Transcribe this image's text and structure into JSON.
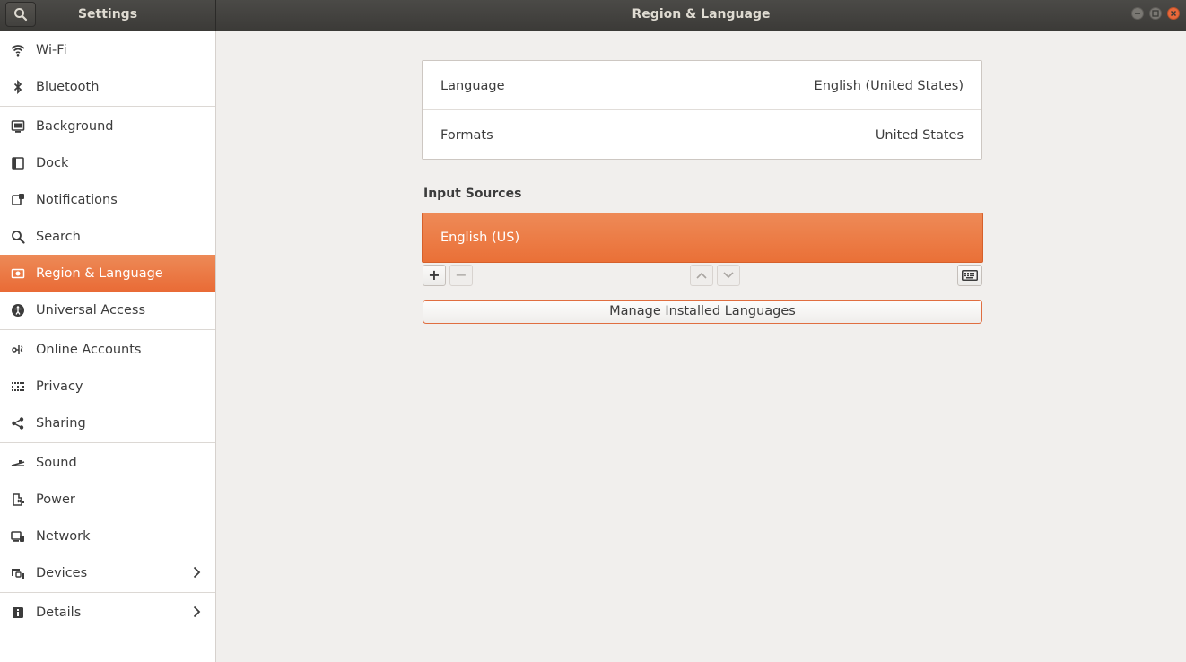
{
  "titlebar": {
    "app_title": "Settings",
    "window_title": "Region & Language"
  },
  "sidebar": {
    "items": [
      {
        "label": "Wi-Fi",
        "icon": "wifi-icon"
      },
      {
        "label": "Bluetooth",
        "icon": "bluetooth-icon"
      },
      {
        "label": "Background",
        "icon": "background-icon"
      },
      {
        "label": "Dock",
        "icon": "dock-icon"
      },
      {
        "label": "Notifications",
        "icon": "notifications-icon"
      },
      {
        "label": "Search",
        "icon": "search-icon"
      },
      {
        "label": "Region & Language",
        "icon": "region-icon",
        "active": true
      },
      {
        "label": "Universal Access",
        "icon": "accessibility-icon"
      },
      {
        "label": "Online Accounts",
        "icon": "online-accounts-icon"
      },
      {
        "label": "Privacy",
        "icon": "privacy-icon"
      },
      {
        "label": "Sharing",
        "icon": "sharing-icon"
      },
      {
        "label": "Sound",
        "icon": "sound-icon"
      },
      {
        "label": "Power",
        "icon": "power-icon"
      },
      {
        "label": "Network",
        "icon": "network-icon"
      },
      {
        "label": "Devices",
        "icon": "devices-icon",
        "has_submenu": true
      },
      {
        "label": "Details",
        "icon": "details-icon",
        "has_submenu": true
      }
    ]
  },
  "main": {
    "language_row": {
      "label": "Language",
      "value": "English (United States)"
    },
    "formats_row": {
      "label": "Formats",
      "value": "United States"
    },
    "input_sources_heading": "Input Sources",
    "input_sources": [
      {
        "label": "English (US)",
        "selected": true
      }
    ],
    "toolbar": {
      "add": "+",
      "remove": "−"
    },
    "manage_button": "Manage Installed Languages"
  },
  "colors": {
    "accent": "#e96b36",
    "titlebar": "#3b3a37",
    "background": "#f1efed"
  }
}
